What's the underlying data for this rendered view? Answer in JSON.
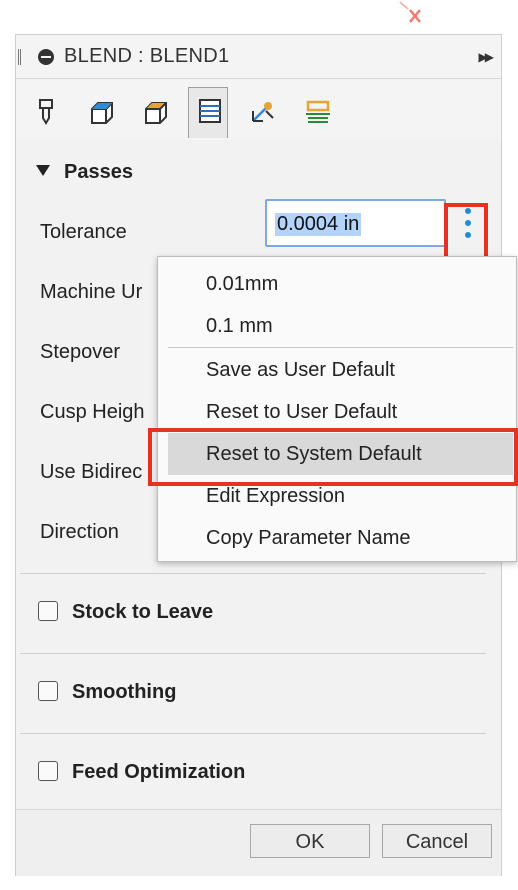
{
  "window": {
    "title": "BLEND : BLEND1"
  },
  "tabs": [
    {
      "name": "tool"
    },
    {
      "name": "geometry"
    },
    {
      "name": "heights"
    },
    {
      "name": "passes",
      "active": true
    },
    {
      "name": "linking"
    },
    {
      "name": "post"
    }
  ],
  "passes": {
    "header": "Passes",
    "rows": [
      {
        "label": "Tolerance"
      },
      {
        "label": "Machine Ur"
      },
      {
        "label": "Stepover"
      },
      {
        "label": "Cusp Heigh"
      },
      {
        "label": "Use Bidirec"
      },
      {
        "label": "Direction"
      }
    ],
    "tolerance_value": "0.0004 in"
  },
  "context_menu": {
    "items": [
      {
        "label": "0.01mm"
      },
      {
        "label": "0.1 mm"
      },
      {
        "label": "Save as User Default"
      },
      {
        "label": "Reset to User Default"
      },
      {
        "label": "Reset to System Default",
        "highlighted": true
      },
      {
        "label": "Edit Expression"
      },
      {
        "label": "Copy Parameter Name"
      }
    ]
  },
  "sections": [
    {
      "label": "Stock to Leave",
      "checked": false
    },
    {
      "label": "Smoothing",
      "checked": false
    },
    {
      "label": "Feed Optimization",
      "checked": false
    }
  ],
  "footer": {
    "ok_label": "OK",
    "cancel_label": "Cancel"
  },
  "colors": {
    "accent_blue": "#1a8fd6",
    "highlight_red": "#e53322",
    "selection": "#b3d3fb"
  }
}
